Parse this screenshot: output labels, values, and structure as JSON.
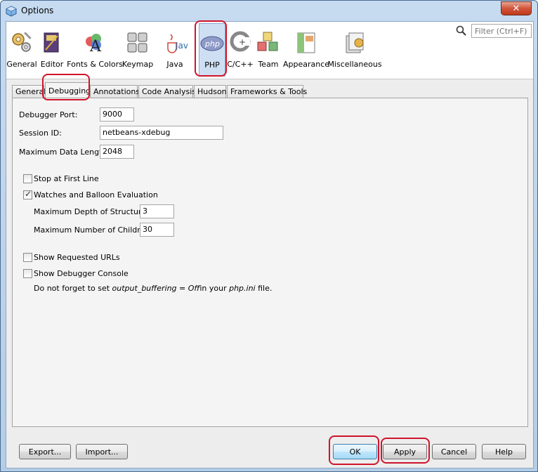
{
  "window": {
    "title": "Options",
    "close_glyph": "✕"
  },
  "categories": [
    {
      "id": "general",
      "label": "General",
      "icon": "gears-icon"
    },
    {
      "id": "editor",
      "label": "Editor",
      "icon": "editor-book-icon"
    },
    {
      "id": "fonts",
      "label": "Fonts & Colors",
      "icon": "fonts-colors-icon"
    },
    {
      "id": "keymap",
      "label": "Keymap",
      "icon": "keyboard-icon"
    },
    {
      "id": "java",
      "label": "Java",
      "icon": "java-cup-icon"
    },
    {
      "id": "php",
      "label": "PHP",
      "icon": "php-icon",
      "logo_text": "php",
      "selected": true
    },
    {
      "id": "cpp",
      "label": "C/C++",
      "icon": "cpp-icon"
    },
    {
      "id": "team",
      "label": "Team",
      "icon": "team-cubes-icon"
    },
    {
      "id": "appearance",
      "label": "Appearance",
      "icon": "appearance-icon"
    },
    {
      "id": "misc",
      "label": "Miscellaneous",
      "icon": "misc-icon"
    }
  ],
  "filter": {
    "placeholder": "Filter (Ctrl+F)"
  },
  "tabs": [
    {
      "label": "General"
    },
    {
      "label": "Debugging",
      "active": true
    },
    {
      "label": "Annotations"
    },
    {
      "label": "Code Analysis"
    },
    {
      "label": "Hudson"
    },
    {
      "label": "Frameworks & Tools"
    }
  ],
  "debugging": {
    "port_label": "Debugger Port:",
    "port_value": "9000",
    "session_label": "Session ID:",
    "session_value": "netbeans-xdebug",
    "maxlen_label": "Maximum Data Length:",
    "maxlen_value": "2048",
    "stop_first_line": {
      "label": "Stop at First Line",
      "checked": false
    },
    "watches": {
      "label": "Watches and Balloon Evaluation",
      "checked": true
    },
    "depth_label": "Maximum Depth of Structures:",
    "depth_value": "3",
    "children_label": "Maximum Number of Children:",
    "children_value": "30",
    "show_urls": {
      "label": "Show Requested URLs",
      "checked": false
    },
    "show_console": {
      "label": "Show Debugger Console",
      "checked": false
    },
    "note": {
      "prefix": "Do not forget to set ",
      "setting": "output_buffering = Off",
      "middle": "in your ",
      "file": "php.ini",
      "suffix": " file."
    }
  },
  "buttons": {
    "export": "Export...",
    "import": "Import...",
    "ok": "OK",
    "apply": "Apply",
    "cancel": "Cancel",
    "help": "Help"
  },
  "colors": {
    "highlight": "#d0142b",
    "selected_bg": "#cfdff3"
  }
}
